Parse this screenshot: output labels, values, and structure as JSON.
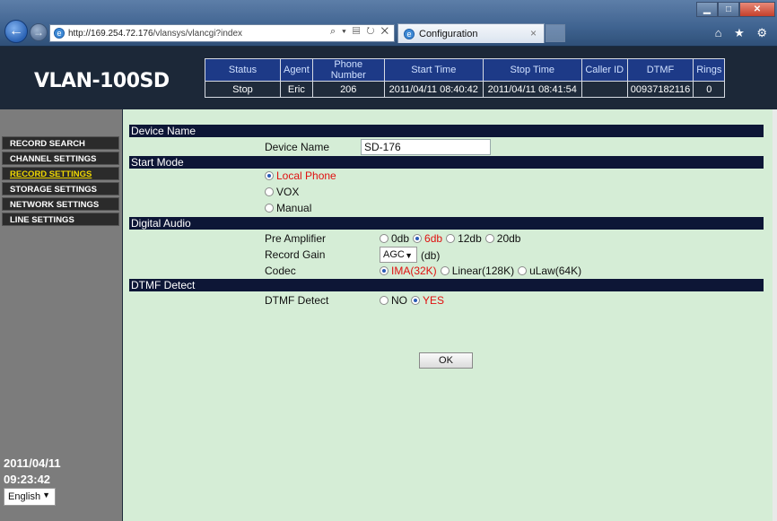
{
  "browser": {
    "url_host": "http://169.254.72.176",
    "url_path": "/vlansys/vlancgi?index",
    "address_tools": "⌕ ▾ ▤ ↻ ✕",
    "tab_title": "Configuration",
    "tab_close": "×",
    "back_glyph": "←",
    "forward_glyph": "→",
    "ie_glyph": "e",
    "win_min": "▁",
    "win_max": "□",
    "win_close": "✕",
    "right_tools": "⌂ ★ ⚙"
  },
  "app": {
    "logo": "VLAN-100SD"
  },
  "status_table": {
    "headers": [
      "Status",
      "Agent",
      "Phone Number",
      "Start Time",
      "Stop Time",
      "Caller ID",
      "DTMF",
      "Rings"
    ],
    "values": [
      "Stop",
      "Eric",
      "206",
      "2011/04/11 08:40:42",
      "2011/04/11 08:41:54",
      "",
      "00937182116",
      "0"
    ]
  },
  "sidebar": {
    "items": [
      {
        "label": "Record Search",
        "active": false
      },
      {
        "label": "Channel Settings",
        "active": false
      },
      {
        "label": "Record Settings",
        "active": true
      },
      {
        "label": "Storage Settings",
        "active": false
      },
      {
        "label": "Network Settings",
        "active": false
      },
      {
        "label": "Line Settings",
        "active": false
      }
    ],
    "date": "2011/04/11",
    "time": "09:23:42",
    "language": "English"
  },
  "form": {
    "section_device": "Device Name",
    "device_name_label": "Device Name",
    "device_name_value": "SD-176",
    "section_start": "Start Mode",
    "start_modes": [
      "Local Phone",
      "VOX",
      "Manual"
    ],
    "start_mode_selected": "Local Phone",
    "section_audio": "Digital Audio",
    "pre_amp_label": "Pre Amplifier",
    "pre_amp_options": [
      "0db",
      "6db",
      "12db",
      "20db"
    ],
    "pre_amp_selected": "6db",
    "record_gain_label": "Record Gain",
    "record_gain_value": "AGC",
    "record_gain_unit": "(db)",
    "codec_label": "Codec",
    "codec_options": [
      "IMA(32K)",
      "Linear(128K)",
      "uLaw(64K)"
    ],
    "codec_selected": "IMA(32K)",
    "section_dtmf": "DTMF Detect",
    "dtmf_label": "DTMF Detect",
    "dtmf_options": [
      "NO",
      "YES"
    ],
    "dtmf_selected": "YES",
    "ok_label": "OK"
  },
  "colors": {
    "section_bar": "#0d1636",
    "content_bg": "#d5edd6",
    "active_menu": "#f0d800",
    "selected_option": "#e01010"
  }
}
